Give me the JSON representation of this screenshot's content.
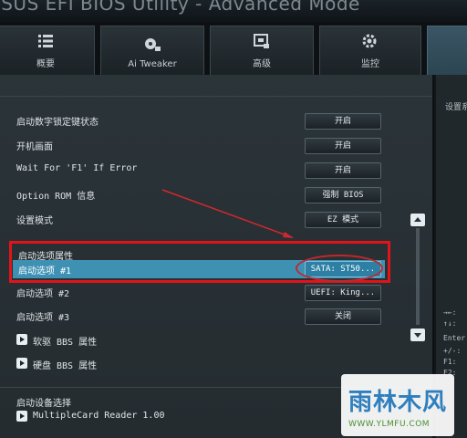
{
  "window": {
    "title": "/SUS EFI BIOS Utility - Advanced Mode"
  },
  "tabs": [
    {
      "label": "概要",
      "icon": "list-icon"
    },
    {
      "label": "Ai Tweaker",
      "icon": "fan-icon"
    },
    {
      "label": "高级",
      "icon": "chip-icon"
    },
    {
      "label": "监控",
      "icon": "gear-icon"
    }
  ],
  "settings": [
    {
      "label": "启动数字锁定键状态",
      "value": "开启"
    },
    {
      "label": "开机画面",
      "value": "开启"
    },
    {
      "label": "Wait For 'F1' If Error",
      "value": "开启"
    },
    {
      "label": "Option ROM 信息",
      "value": "强制 BIOS"
    },
    {
      "label": "设置模式",
      "value": "EZ 模式"
    }
  ],
  "boot_group": {
    "title": "启动选项属性",
    "selected": {
      "label": "启动选项 #1",
      "value": "SATA: ST50..."
    },
    "options": [
      {
        "label": "启动选项 #2",
        "value": "UEFI: King..."
      },
      {
        "label": "启动选项 #3",
        "value": "关闭"
      }
    ]
  },
  "submenus": [
    {
      "label": "软驱 BBS 属性"
    },
    {
      "label": "硬盘 BBS 属性"
    }
  ],
  "device_select": {
    "title": "启动设备选择",
    "item": "MultipleCard Reader 1.00"
  },
  "help": {
    "title": "设置系",
    "keys": [
      "→←:",
      "↑↓:",
      "Enter",
      "+/-:",
      "F1:",
      "F2:"
    ]
  },
  "watermark": {
    "text": "雨林木风",
    "url": "WWW.YLMFU.COM"
  }
}
